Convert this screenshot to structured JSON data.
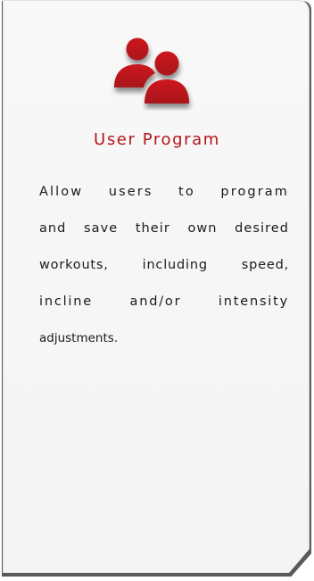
{
  "feature": {
    "title": "User Program",
    "description_lines": [
      "Allow users to program",
      "and save their own desired",
      "workouts, including speed,",
      "incline and/or intensity",
      "adjustments."
    ],
    "icon": "users-icon",
    "accent_color": "#b3151b"
  }
}
